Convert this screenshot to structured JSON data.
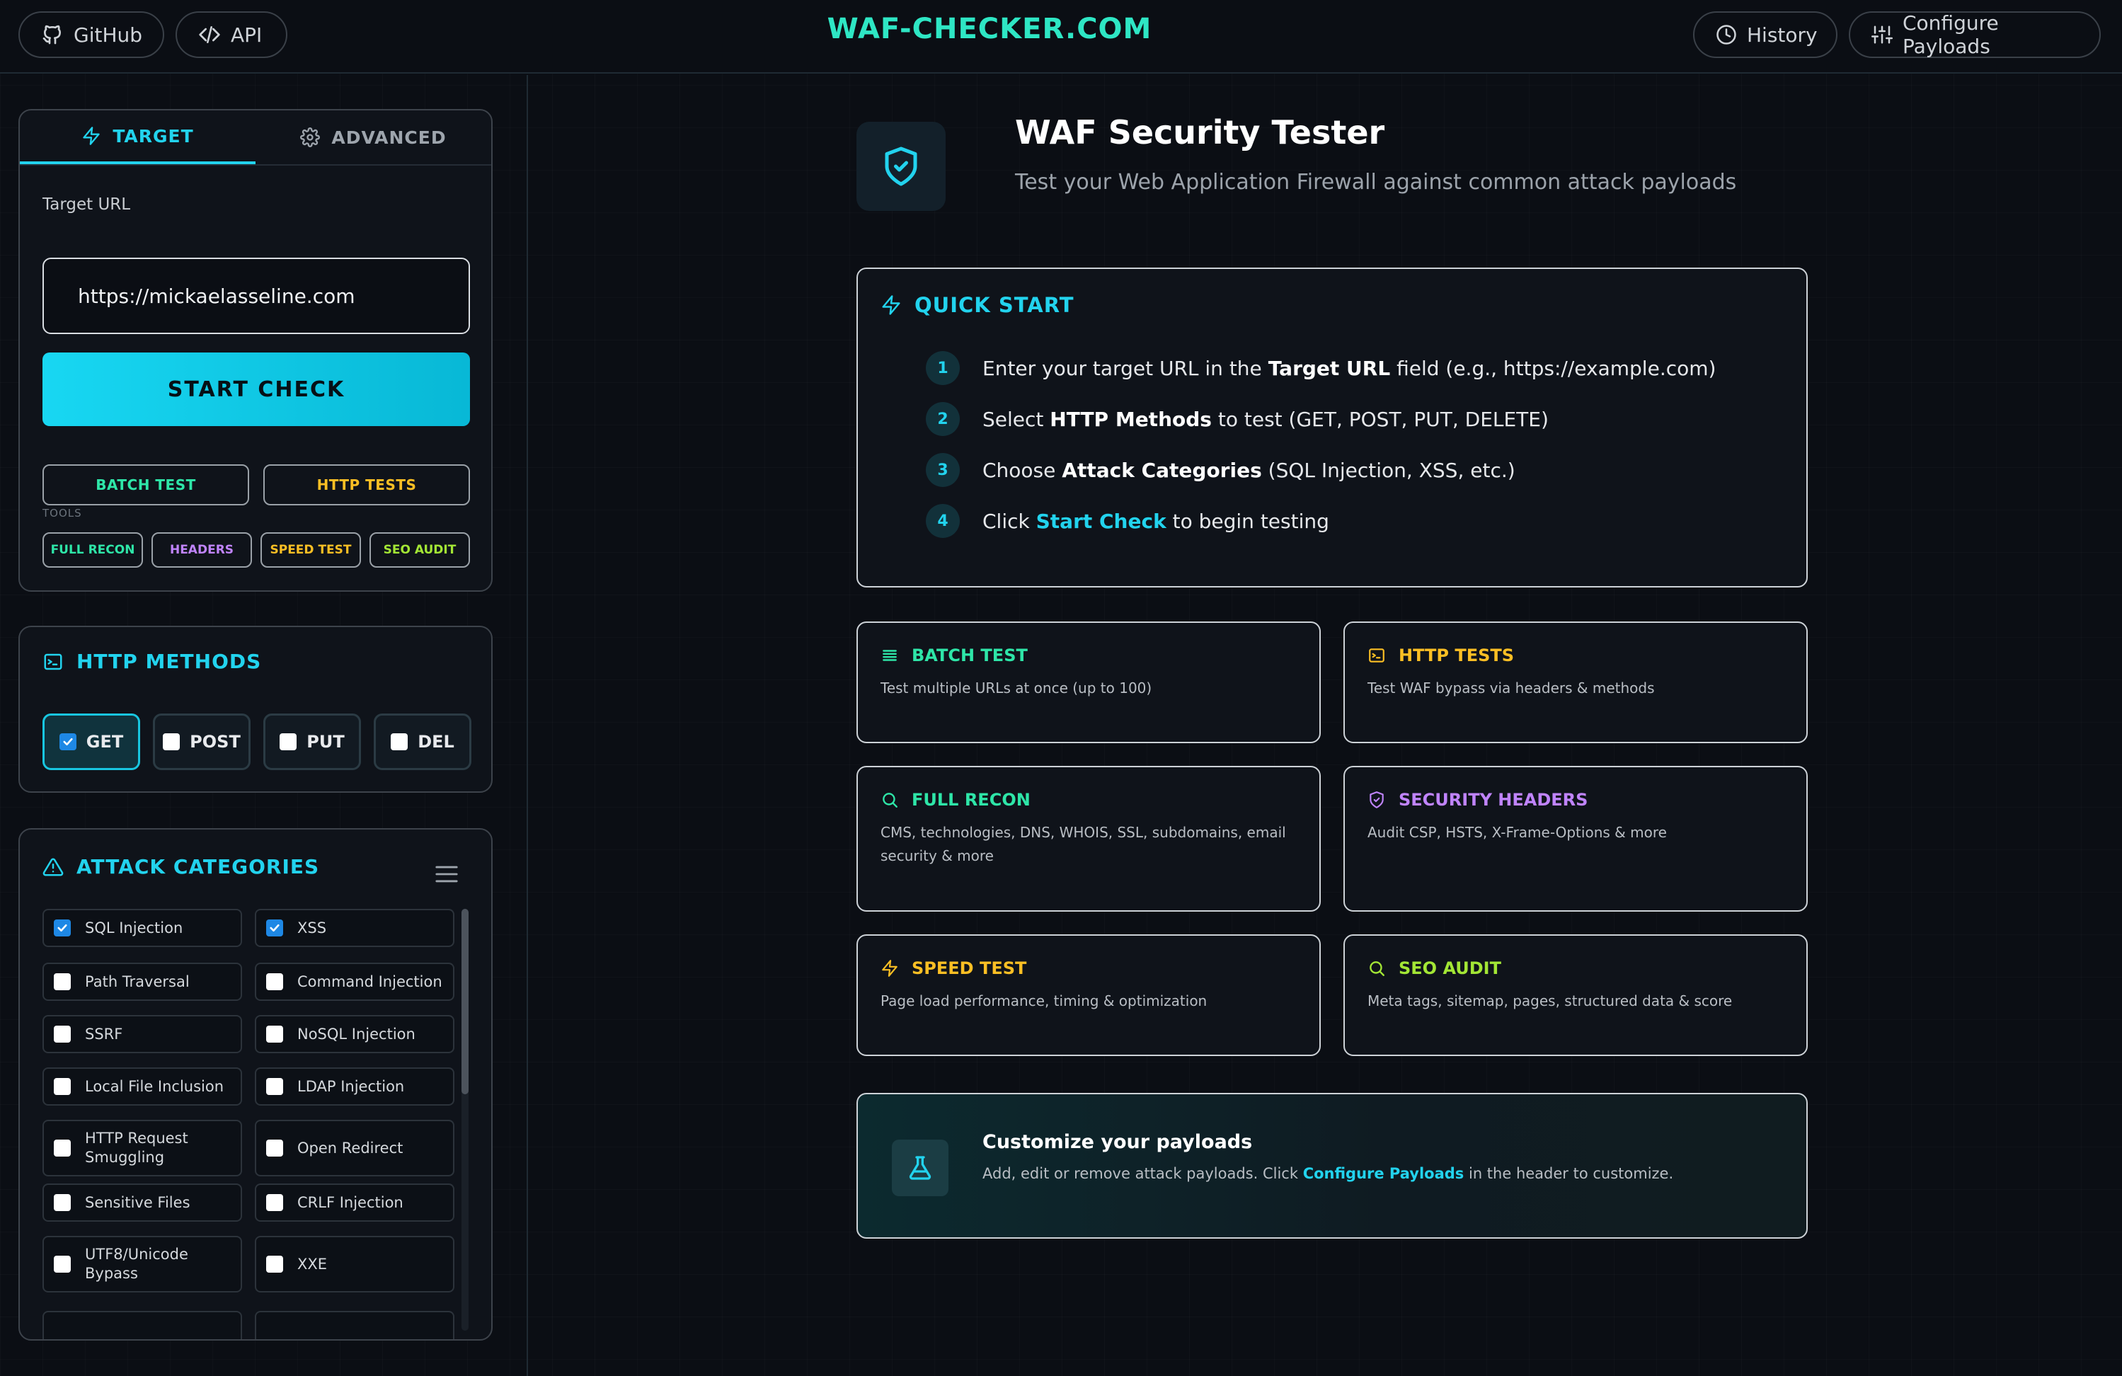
{
  "header": {
    "github_label": "GitHub",
    "api_label": "API",
    "brand": "WAF-CHECKER.COM",
    "history_label": "History",
    "configure_label": "Configure Payloads"
  },
  "sidebar": {
    "tabs": [
      {
        "label": "TARGET",
        "active": true
      },
      {
        "label": "ADVANCED",
        "active": false
      }
    ],
    "target_url_label": "Target URL",
    "target_url_value": "https://mickaelasseline.com",
    "start_check_label": "START CHECK",
    "batch_test_label": "BATCH TEST",
    "http_tests_label": "HTTP TESTS",
    "tools_label": "TOOLS",
    "tools": [
      {
        "label": "FULL RECON",
        "color": "#2ee6a8"
      },
      {
        "label": "HEADERS",
        "color": "#c084fc"
      },
      {
        "label": "SPEED TEST",
        "color": "#fbbf24"
      },
      {
        "label": "SEO AUDIT",
        "color": "#a3e635"
      }
    ],
    "http_methods": {
      "title": "HTTP METHODS",
      "items": [
        {
          "label": "GET",
          "checked": true
        },
        {
          "label": "POST",
          "checked": false
        },
        {
          "label": "PUT",
          "checked": false
        },
        {
          "label": "DEL",
          "checked": false
        }
      ]
    },
    "attack_categories": {
      "title": "ATTACK CATEGORIES",
      "items": [
        {
          "label": "SQL Injection",
          "checked": true
        },
        {
          "label": "XSS",
          "checked": true
        },
        {
          "label": "Path Traversal",
          "checked": false
        },
        {
          "label": "Command Injection",
          "checked": false
        },
        {
          "label": "SSRF",
          "checked": false
        },
        {
          "label": "NoSQL Injection",
          "checked": false
        },
        {
          "label": "Local File Inclusion",
          "checked": false
        },
        {
          "label": "LDAP Injection",
          "checked": false
        },
        {
          "label": "HTTP Request Smuggling",
          "checked": false
        },
        {
          "label": "Open Redirect",
          "checked": false
        },
        {
          "label": "Sensitive Files",
          "checked": false
        },
        {
          "label": "CRLF Injection",
          "checked": false
        },
        {
          "label": "UTF8/Unicode Bypass",
          "checked": false
        },
        {
          "label": "XXE",
          "checked": false
        }
      ]
    }
  },
  "main": {
    "title": "WAF Security Tester",
    "subtitle": "Test your Web Application Firewall against common attack payloads",
    "quick_start": {
      "title": "QUICK START",
      "steps": [
        {
          "num": "1",
          "pre": "Enter your target URL in the ",
          "bold": "Target URL",
          "post": " field (e.g., https://example.com)"
        },
        {
          "num": "2",
          "pre": "Select ",
          "bold": "HTTP Methods",
          "post": " to test (GET, POST, PUT, DELETE)"
        },
        {
          "num": "3",
          "pre": "Choose ",
          "bold": "Attack Categories",
          "post": " (SQL Injection, XSS, etc.)"
        },
        {
          "num": "4",
          "pre": "Click ",
          "bold": "Start Check",
          "post": " to begin testing"
        }
      ]
    },
    "features": [
      {
        "title": "BATCH TEST",
        "desc": "Test multiple URLs at once (up to 100)",
        "color": "#2ee6a8",
        "icon": "list-icon"
      },
      {
        "title": "HTTP TESTS",
        "desc": "Test WAF bypass via headers & methods",
        "color": "#fbbf24",
        "icon": "terminal-icon"
      },
      {
        "title": "FULL RECON",
        "desc": "CMS, technologies, DNS, WHOIS, SSL, subdomains, email security & more",
        "color": "#2ee6a8",
        "icon": "search-icon"
      },
      {
        "title": "SECURITY HEADERS",
        "desc": "Audit CSP, HSTS, X-Frame-Options & more",
        "color": "#c084fc",
        "icon": "shield-check-icon"
      },
      {
        "title": "SPEED TEST",
        "desc": "Page load performance, timing & optimization",
        "color": "#fbbf24",
        "icon": "bolt-icon"
      },
      {
        "title": "SEO AUDIT",
        "desc": "Meta tags, sitemap, pages, structured data & score",
        "color": "#a3e635",
        "icon": "search-icon"
      }
    ],
    "customize": {
      "title": "Customize your payloads",
      "desc_pre": "Add, edit or remove attack payloads. Click ",
      "desc_link": "Configure Payloads",
      "desc_post": " in the header to customize."
    }
  }
}
